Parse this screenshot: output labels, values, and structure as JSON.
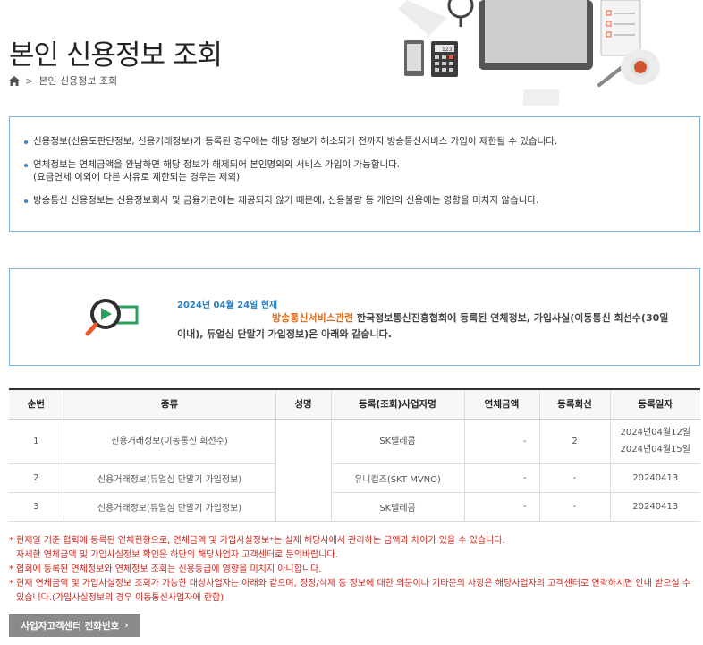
{
  "header": {
    "title": "본인 신용정보 조회",
    "breadcrumb": [
      "본인 신용정보 조회"
    ]
  },
  "icons": {
    "home": "home-icon",
    "breadcrumb_separator": "chevron-right-icon",
    "status": "magnifier-video-icon",
    "button_arrow": "chevron-right-icon"
  },
  "notice": {
    "items": [
      {
        "text": "신용정보(신용도판단정보, 신용거래정보)가 등록된 경우에는 해당 정보가 해소되기 전까지 방송통신서비스 가입이 제한될 수 있습니다."
      },
      {
        "text": "연체정보는 연체금액을 완납하면 해당 정보가 해제되어 본인명의의 서비스 가입이 가능합니다.",
        "sub": "(요금연체 이외에 다른 사유로 제한되는 경우는 제외)"
      },
      {
        "text": "방송통신 신용정보는 신용정보회사 및 금융기관에는 제공되지 않기 때문에, 신용불량 등 개인의 신용에는 영향을 미치지 않습니다."
      }
    ]
  },
  "status": {
    "date_line": "2024년 04월 24일 현재",
    "highlight": "방송통신서비스관련",
    "message": " 한국정보통신진흥협회에 등록된 연체정보, 가입사실(이동통신 회선수(30일 이내), 듀얼심 단말기 가입정보)은 아래와 같습니다."
  },
  "table": {
    "headers": [
      "순번",
      "종류",
      "성명",
      "등록(조회)사업자명",
      "연체금액",
      "등록회선",
      "등록일자"
    ],
    "rows": [
      {
        "no": "1",
        "type": "신용거래정보(이동통신 회선수)",
        "name": "",
        "company": "SK텔레콤",
        "amount": "-",
        "lines": "2",
        "dates": [
          "2024년04월12일",
          "2024년04월15일"
        ]
      },
      {
        "no": "2",
        "type": "신용거래정보(듀얼심 단말기 가입정보)",
        "name": "",
        "company": "유니컵즈(SKT MVNO)",
        "amount": "-",
        "lines": "-",
        "dates": [
          "20240413"
        ]
      },
      {
        "no": "3",
        "type": "신용거래정보(듀얼심 단말기 가입정보)",
        "name": "",
        "company": "SK텔레콤",
        "amount": "-",
        "lines": "-",
        "dates": [
          "20240413"
        ]
      }
    ]
  },
  "notes": [
    "현재일 기준 협회에 등록된 연체현황으로, 연체금액 및 가입사실정보*는 실제 해당사에서 관리하는 금액과 차이가 있을 수 있습니다.",
    "자세한 연체금액 및 가입사실정보 확인은 하단의 해당사업자 고객센터로 문의바랍니다.",
    "협회에 등록된 연체정보와 연체정보 조회는 신용등급에 영향을 미치지 아니합니다.",
    "현재 연체금액 및 가입사실정보 조회가 가능한 대상사업자는 아래와 같으며, 정정/삭제 등 정보에 대한 의문이나 기타문의 사항은 해당사업자의 고객센터로 연락하시면 안내 받으실 수 있습니다.(가입사실정보의 경우 이동통신사업자에 한함)"
  ],
  "button": {
    "label": "사업자고객센터 전화번호"
  },
  "colors": {
    "accent_blue": "#2a7fc2",
    "highlight_orange": "#e06b1a",
    "note_red": "#d0241b",
    "box_border": "#7fb2d9",
    "button_bg": "#8a8a8a"
  }
}
